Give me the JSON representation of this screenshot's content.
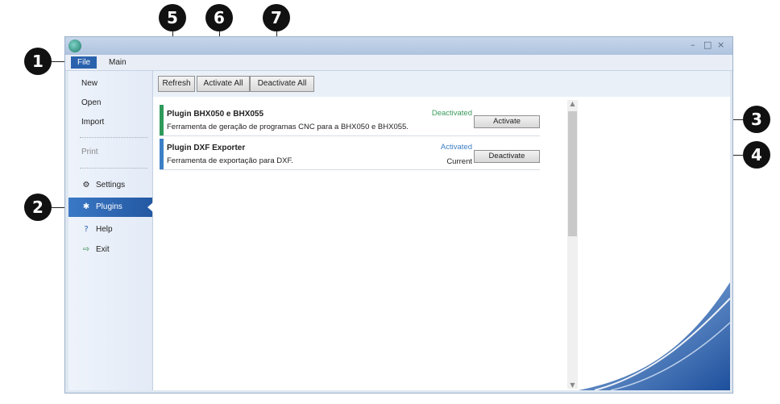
{
  "callouts": [
    "1",
    "2",
    "3",
    "4",
    "5",
    "6",
    "7"
  ],
  "menu": {
    "file_label": "File",
    "main_label": "Main"
  },
  "sidebar": {
    "new": "New",
    "open": "Open",
    "import": "Import",
    "print": "Print",
    "settings": "Settings",
    "plugins": "Plugins",
    "help": "Help",
    "exit": "Exit"
  },
  "toolbar": {
    "refresh": "Refresh",
    "activate_all": "Activate All",
    "deactivate_all": "Deactivate All"
  },
  "plugins": [
    {
      "title": "Plugin BHX050 e BHX055",
      "description": "Ferramenta de geração de programas CNC para a BHX050 e BHX055.",
      "status": "Deactivated",
      "status_color": "#3a9a5a",
      "current": "",
      "button": "Activate",
      "bar_color": "#2f9a5a"
    },
    {
      "title": "Plugin DXF Exporter",
      "description": "Ferramenta de exportação para DXF.",
      "status": "Activated",
      "status_color": "#3d7fc5",
      "current": "Current",
      "button": "Deactivate",
      "bar_color": "#3d7fc5"
    }
  ],
  "colors": {
    "accent": "#2a62ad",
    "window_frame": "#dfe7f1"
  }
}
